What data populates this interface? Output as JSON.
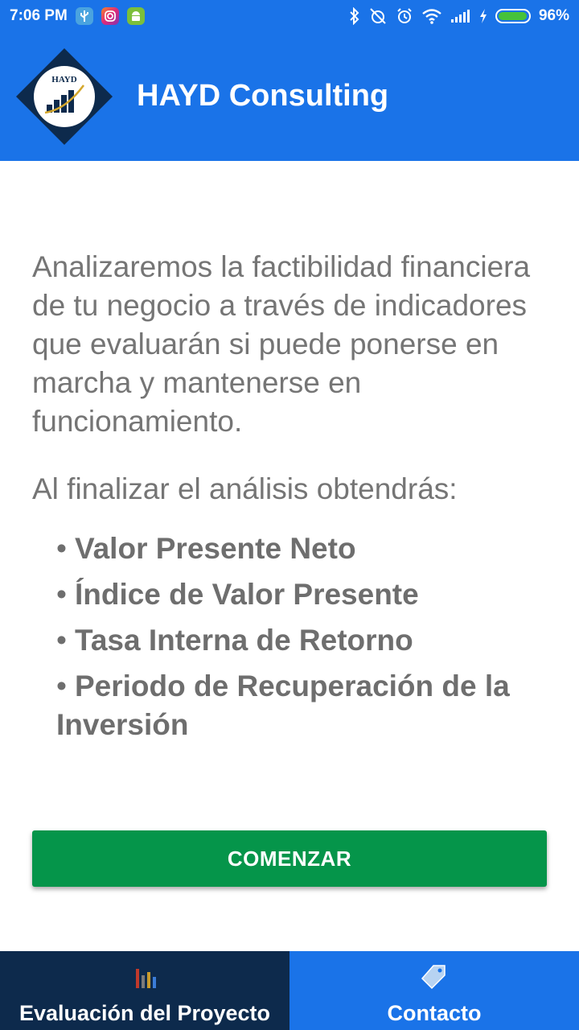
{
  "status_bar": {
    "time": "7:06 PM",
    "battery": "96%",
    "battery_level": 0.96,
    "notification_icons": [
      "usb-icon",
      "instagram-icon",
      "android-icon"
    ],
    "system_icons": [
      "bluetooth-icon",
      "alarm-off-icon",
      "alarm-icon",
      "wifi-icon",
      "signal-icon",
      "charging-icon",
      "battery-icon"
    ]
  },
  "app_bar": {
    "title": "HAYD Consulting",
    "logo_text": "HAYD"
  },
  "main": {
    "intro": "Analizaremos la factibilidad financiera de tu negocio a través de indicadores que evaluarán si puede ponerse en marcha y mantenerse en funcionamiento.",
    "results_heading": "Al finalizar el análisis obtendrás:",
    "bullet": "•",
    "benefits": [
      "Valor Presente Neto",
      "Índice de Valor Presente",
      "Tasa Interna de Retorno",
      "Periodo de Recuperación de la Inversión"
    ],
    "start_button": "COMENZAR"
  },
  "bottom_nav": {
    "tabs": [
      {
        "label": "Evaluación del Proyecto",
        "icon": "bar-chart-icon",
        "active": true
      },
      {
        "label": "Contacto",
        "icon": "tag-icon",
        "active": false
      }
    ]
  },
  "colors": {
    "primary": "#1a73e8",
    "active_tab": "#0d2a4c",
    "button": "#05954a",
    "text": "#757575"
  }
}
